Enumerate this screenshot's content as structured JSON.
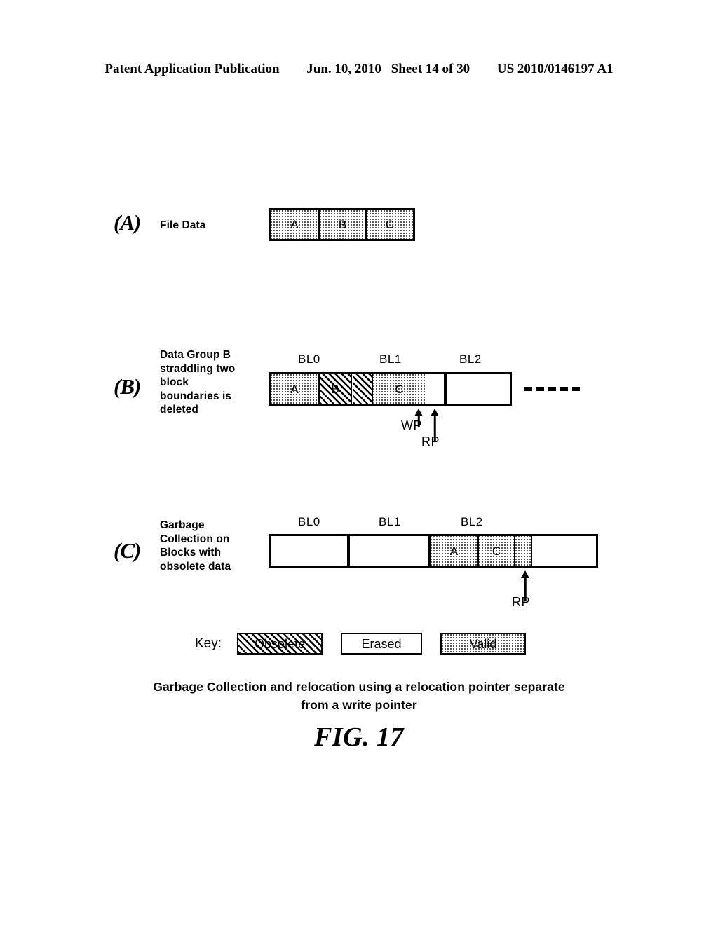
{
  "header": {
    "publication": "Patent Application Publication",
    "date": "Jun. 10, 2010",
    "sheet": "Sheet 14 of 30",
    "patent_number": "US 2010/0146197 A1"
  },
  "sections": [
    {
      "letter": "(A)",
      "caption_lines": [
        "File Data"
      ],
      "cells": [
        {
          "label": "A",
          "fill": "valid"
        },
        {
          "label": "B",
          "fill": "valid"
        },
        {
          "label": "C",
          "fill": "valid"
        }
      ]
    },
    {
      "letter": "(B)",
      "caption_lines": [
        "Data Group B",
        "straddling two",
        "block",
        "boundaries is",
        "deleted"
      ],
      "block_labels": [
        "BL0",
        "BL1",
        "BL2"
      ],
      "cells": [
        {
          "label": "A",
          "fill": "valid"
        },
        {
          "label": "B",
          "fill": "obsolete"
        },
        {
          "label": "",
          "fill": "obsolete"
        },
        {
          "label": "C",
          "fill": "valid"
        },
        {
          "label": "",
          "fill": "erased"
        },
        {
          "label": "",
          "fill": "erased"
        }
      ],
      "pointers": [
        "WP",
        "RP"
      ],
      "trailing_dashes": 5
    },
    {
      "letter": "(C)",
      "caption_lines": [
        "Garbage",
        "Collection on",
        "Blocks with",
        "obsolete data"
      ],
      "block_labels": [
        "BL0",
        "BL1",
        "BL2"
      ],
      "cells": [
        {
          "label": "",
          "fill": "erased"
        },
        {
          "label": "",
          "fill": "erased"
        },
        {
          "label": "A",
          "fill": "valid"
        },
        {
          "label": "C",
          "fill": "valid"
        },
        {
          "label": "",
          "fill": "valid"
        },
        {
          "label": "",
          "fill": "erased"
        }
      ],
      "pointers": [
        "RP"
      ]
    }
  ],
  "key": {
    "word": "Key:",
    "items": [
      {
        "label": "Obsolete",
        "fill": "obsolete"
      },
      {
        "label": "Erased",
        "fill": "erased"
      },
      {
        "label": "Valid",
        "fill": "valid"
      }
    ]
  },
  "figure": {
    "caption_line1": "Garbage Collection and relocation using a relocation pointer separate",
    "caption_line2": "from a write pointer",
    "number": "FIG. 17"
  }
}
